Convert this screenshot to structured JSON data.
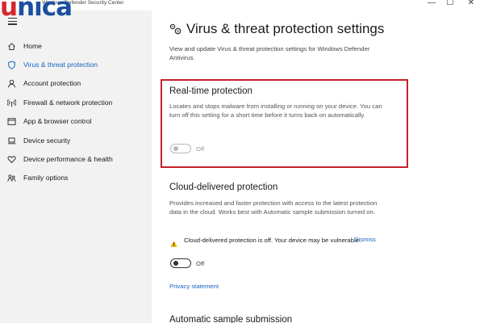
{
  "window": {
    "title": "Windows Defender Security Center",
    "minimize": "—",
    "maximize": "☐",
    "close": "✕"
  },
  "logo": {
    "part1": "u",
    "part2": "nica"
  },
  "sidebar": {
    "items": [
      {
        "label": "Home",
        "icon": "home-icon"
      },
      {
        "label": "Virus & threat protection",
        "icon": "shield-icon",
        "active": true
      },
      {
        "label": "Account protection",
        "icon": "person-icon"
      },
      {
        "label": "Firewall & network protection",
        "icon": "antenna-icon"
      },
      {
        "label": "App & browser control",
        "icon": "window-icon"
      },
      {
        "label": "Device security",
        "icon": "laptop-icon"
      },
      {
        "label": "Device performance & health",
        "icon": "heart-icon"
      },
      {
        "label": "Family options",
        "icon": "family-icon"
      }
    ]
  },
  "main": {
    "title": "Virus & threat protection settings",
    "title_icon": "gears-icon",
    "description": "View and update Virus & threat protection settings for Windows Defender Antivirus.",
    "realtime": {
      "title": "Real-time protection",
      "description": "Locates and stops malware from installing or running on your device. You can turn off this setting for a short time before it turns back on automatically.",
      "toggle_label": "Off"
    },
    "cloud": {
      "title": "Cloud-delivered protection",
      "description": "Provides increased and faster protection with access to the latest protection data in the cloud.  Works best with Automatic sample submission turned on.",
      "warning": "Cloud-delivered protection is off. Your device may be vulnerable.",
      "dismiss": "Dismiss",
      "toggle_label": "Off",
      "privacy_link": "Privacy statement"
    },
    "next_section_title": "Automatic sample submission"
  },
  "colors": {
    "accent": "#1565c0",
    "highlight_box": "#c5202c",
    "warning": "#f0b400",
    "sidebar_bg": "#f2f2f2"
  }
}
